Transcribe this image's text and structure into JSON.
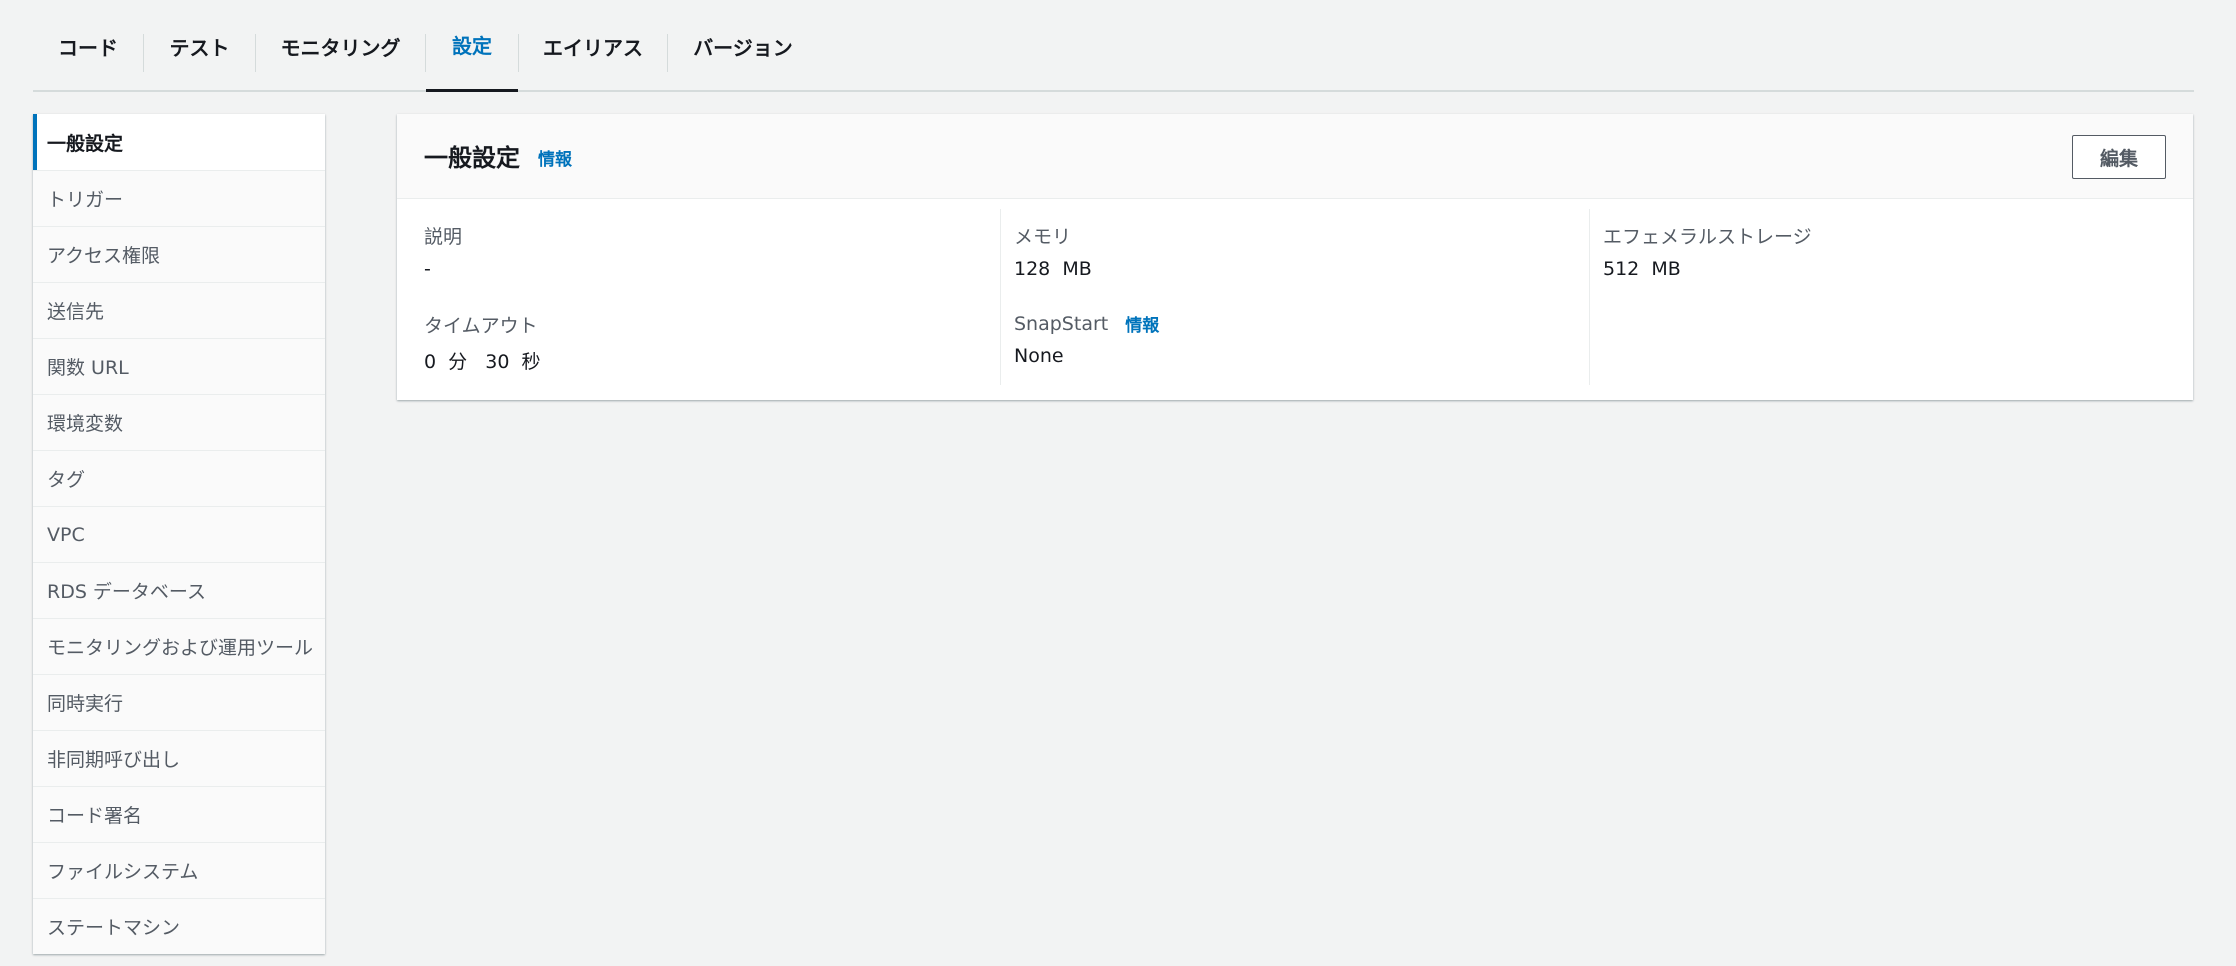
{
  "tabs": [
    {
      "label": "コード"
    },
    {
      "label": "テスト"
    },
    {
      "label": "モニタリング"
    },
    {
      "label": "設定",
      "active": true
    },
    {
      "label": "エイリアス"
    },
    {
      "label": "バージョン"
    }
  ],
  "sidebar": {
    "items": [
      {
        "label": "一般設定",
        "active": true
      },
      {
        "label": "トリガー"
      },
      {
        "label": "アクセス権限"
      },
      {
        "label": "送信先"
      },
      {
        "label": "関数 URL"
      },
      {
        "label": "環境変数"
      },
      {
        "label": "タグ"
      },
      {
        "label": "VPC"
      },
      {
        "label": "RDS データベース"
      },
      {
        "label": "モニタリングおよび運用ツール"
      },
      {
        "label": "同時実行"
      },
      {
        "label": "非同期呼び出し"
      },
      {
        "label": "コード署名"
      },
      {
        "label": "ファイルシステム"
      },
      {
        "label": "ステートマシン"
      }
    ]
  },
  "panel": {
    "title": "一般設定",
    "info_label": "情報",
    "edit_label": "編集",
    "fields": {
      "description": {
        "label": "説明",
        "value": "-"
      },
      "timeout": {
        "label": "タイムアウト",
        "value": "0  分   30  秒"
      },
      "memory": {
        "label": "メモリ",
        "value": "128  MB"
      },
      "snapstart": {
        "label": "SnapStart",
        "info_label": "情報",
        "value": "None"
      },
      "ephemeral_storage": {
        "label": "エフェメラルストレージ",
        "value": "512  MB"
      }
    }
  },
  "colors": {
    "accent": "#0073bb",
    "background": "#f2f3f3",
    "text": "#16191f",
    "muted": "#545b64"
  }
}
